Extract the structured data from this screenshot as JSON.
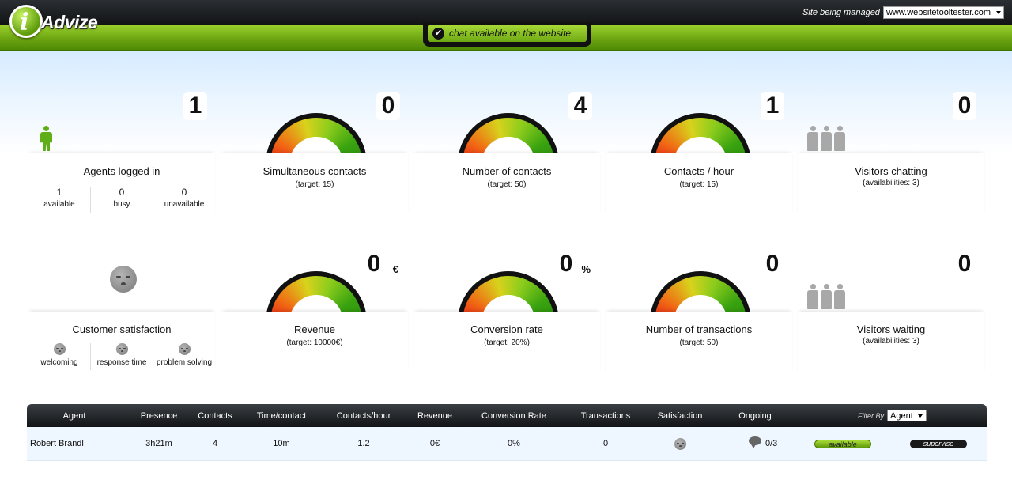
{
  "header": {
    "logo_text": "Advize",
    "site_label": "Site being managed",
    "site_value": "www.websitetooltester.com",
    "chat_status": "chat available on the website"
  },
  "tiles": [
    {
      "value": "1",
      "title": "Agents logged in",
      "stats": [
        {
          "value": "1",
          "label": "available"
        },
        {
          "value": "0",
          "label": "busy"
        },
        {
          "value": "0",
          "label": "unavailable"
        }
      ]
    },
    {
      "value": "0",
      "title": "Simultaneous contacts",
      "sub": "(target: 15)"
    },
    {
      "value": "4",
      "title": "Number of contacts",
      "sub": "(target: 50)"
    },
    {
      "value": "1",
      "title": "Contacts / hour",
      "sub": "(target: 15)"
    },
    {
      "value": "0",
      "title": "Visitors chatting",
      "sub": "(availabilities: 3)"
    },
    {
      "title": "Customer satisfaction",
      "stats": [
        {
          "label": "welcoming"
        },
        {
          "label": "response time"
        },
        {
          "label": "problem solving"
        }
      ]
    },
    {
      "value": "0",
      "unit": "€",
      "title": "Revenue",
      "sub": "(target: 10000€)"
    },
    {
      "value": "0",
      "unit": "%",
      "title": "Conversion rate",
      "sub": "(target: 20%)"
    },
    {
      "value": "0",
      "title": "Number of transactions",
      "sub": "(target: 50)"
    },
    {
      "value": "0",
      "title": "Visitors waiting",
      "sub": "(availabilities: 3)"
    }
  ],
  "table": {
    "headers": [
      "Agent",
      "Presence",
      "Contacts",
      "Time/contact",
      "Contacts/hour",
      "Revenue",
      "Conversion Rate",
      "Transactions",
      "Satisfaction",
      "Ongoing"
    ],
    "filter_label": "Filter By",
    "filter_value": "Agent",
    "rows": [
      {
        "agent": "Robert Brandl",
        "presence": "3h21m",
        "contacts": "4",
        "time_contact": "10m",
        "contacts_hour": "1.2",
        "revenue": "0€",
        "conversion": "0%",
        "transactions": "0",
        "ongoing": "0/3",
        "status": "available",
        "action": "supervise"
      }
    ]
  },
  "colors": {
    "accent_green": "#6aa310",
    "dark": "#121416"
  },
  "icons": [
    "check-icon",
    "agent-person-icon",
    "visitors-icon",
    "neutral-smiley-icon",
    "chat-bubble-icon",
    "dropdown-arrow-icon"
  ]
}
